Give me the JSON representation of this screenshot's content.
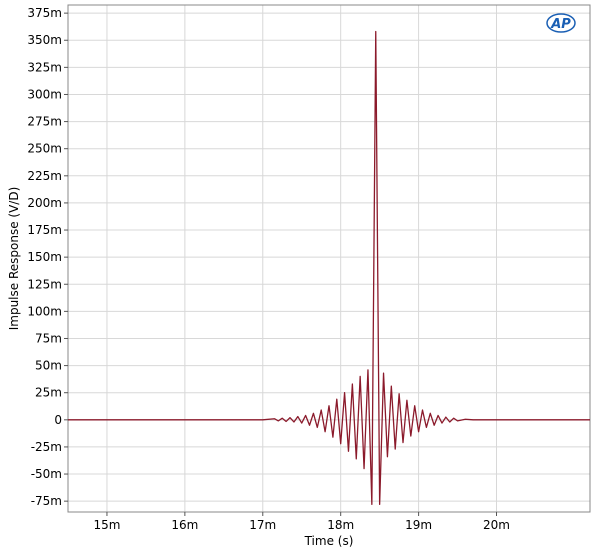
{
  "chart_data": {
    "type": "line",
    "xlabel": "Time (s)",
    "ylabel": "Impulse Response (V/D)",
    "xlim": [
      0.0145,
      0.0212
    ],
    "ylim": [
      -0.085,
      0.3825
    ],
    "grid": true,
    "logo": "AP",
    "x_ticks": [
      {
        "value": 0.015,
        "label": "15m"
      },
      {
        "value": 0.016,
        "label": "16m"
      },
      {
        "value": 0.017,
        "label": "17m"
      },
      {
        "value": 0.018,
        "label": "18m"
      },
      {
        "value": 0.019,
        "label": "19m"
      },
      {
        "value": 0.02,
        "label": "20m"
      }
    ],
    "y_ticks": [
      {
        "value": 0.375,
        "label": "375m"
      },
      {
        "value": 0.35,
        "label": "350m"
      },
      {
        "value": 0.325,
        "label": "325m"
      },
      {
        "value": 0.3,
        "label": "300m"
      },
      {
        "value": 0.275,
        "label": "275m"
      },
      {
        "value": 0.25,
        "label": "250m"
      },
      {
        "value": 0.225,
        "label": "225m"
      },
      {
        "value": 0.2,
        "label": "200m"
      },
      {
        "value": 0.175,
        "label": "175m"
      },
      {
        "value": 0.15,
        "label": "150m"
      },
      {
        "value": 0.125,
        "label": "125m"
      },
      {
        "value": 0.1,
        "label": "100m"
      },
      {
        "value": 0.075,
        "label": "75m"
      },
      {
        "value": 0.05,
        "label": "50m"
      },
      {
        "value": 0.025,
        "label": "25m"
      },
      {
        "value": 0.0,
        "label": "0"
      },
      {
        "value": -0.025,
        "label": "-25m"
      },
      {
        "value": -0.05,
        "label": "-50m"
      },
      {
        "value": -0.075,
        "label": "-75m"
      }
    ],
    "series": [
      {
        "color": "#8b1a2b",
        "points": [
          [
            0.0145,
            0
          ],
          [
            0.017,
            0
          ],
          [
            0.01715,
            0.001
          ],
          [
            0.0172,
            -0.001
          ],
          [
            0.01725,
            0.0015
          ],
          [
            0.0173,
            -0.0015
          ],
          [
            0.01735,
            0.002
          ],
          [
            0.0174,
            -0.002
          ],
          [
            0.01745,
            0.003
          ],
          [
            0.0175,
            -0.003
          ],
          [
            0.01755,
            0.004
          ],
          [
            0.0176,
            -0.005
          ],
          [
            0.01765,
            0.006
          ],
          [
            0.0177,
            -0.007
          ],
          [
            0.01775,
            0.009
          ],
          [
            0.0178,
            -0.011
          ],
          [
            0.01785,
            0.013
          ],
          [
            0.0179,
            -0.016
          ],
          [
            0.01795,
            0.019
          ],
          [
            0.018,
            -0.022
          ],
          [
            0.01805,
            0.025
          ],
          [
            0.0181,
            -0.029
          ],
          [
            0.01815,
            0.033
          ],
          [
            0.0182,
            -0.036
          ],
          [
            0.01825,
            0.04
          ],
          [
            0.0183,
            -0.045
          ],
          [
            0.01835,
            0.046
          ],
          [
            0.0184,
            -0.078
          ],
          [
            0.01845,
            0.358
          ],
          [
            0.0185,
            -0.078
          ],
          [
            0.01855,
            0.043
          ],
          [
            0.0186,
            -0.034
          ],
          [
            0.01865,
            0.031
          ],
          [
            0.0187,
            -0.027
          ],
          [
            0.01875,
            0.024
          ],
          [
            0.0188,
            -0.021
          ],
          [
            0.01885,
            0.018
          ],
          [
            0.0189,
            -0.015
          ],
          [
            0.01895,
            0.013
          ],
          [
            0.019,
            -0.011
          ],
          [
            0.01905,
            0.009
          ],
          [
            0.0191,
            -0.007
          ],
          [
            0.01915,
            0.006
          ],
          [
            0.0192,
            -0.005
          ],
          [
            0.01925,
            0.004
          ],
          [
            0.0193,
            -0.003
          ],
          [
            0.01935,
            0.0025
          ],
          [
            0.0194,
            -0.002
          ],
          [
            0.01945,
            0.0015
          ],
          [
            0.0195,
            -0.001
          ],
          [
            0.0196,
            0.0005
          ],
          [
            0.0197,
            0
          ],
          [
            0.0212,
            0
          ]
        ]
      }
    ]
  }
}
